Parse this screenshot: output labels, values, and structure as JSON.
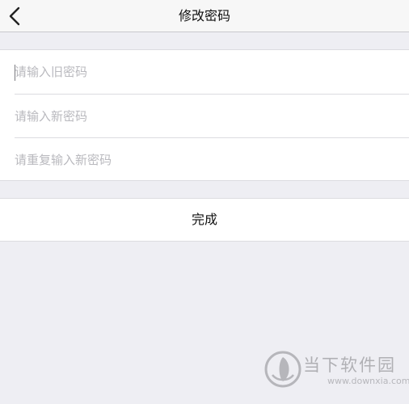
{
  "navbar": {
    "title": "修改密码",
    "back_icon": "chevron-left-icon"
  },
  "form": {
    "old_password": {
      "placeholder": "请输入旧密码",
      "value": ""
    },
    "new_password": {
      "placeholder": "请输入新密码",
      "value": ""
    },
    "confirm_password": {
      "placeholder": "请重复输入新密码",
      "value": ""
    }
  },
  "actions": {
    "done_label": "完成"
  },
  "watermark": {
    "name": "当下软件园",
    "url": "www.downxia.com",
    "logo_icon": "downxia-logo-icon"
  }
}
